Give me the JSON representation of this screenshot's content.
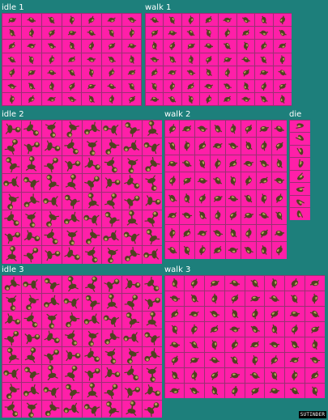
{
  "colors": {
    "background": "#1d7f7b",
    "cell": "#ff1fa8",
    "grid_line": "#9a2f72",
    "sprite_dark": "#4f4220",
    "sprite_light": "#b9a15a"
  },
  "sheet": {
    "sections": [
      {
        "id": "idle-1",
        "label": "idle 1",
        "cols": 7,
        "rows": 7,
        "pose": "small"
      },
      {
        "id": "walk-1",
        "label": "walk 1",
        "cols": 8,
        "rows": 7,
        "pose": "small"
      },
      {
        "id": "idle-2",
        "label": "idle 2",
        "cols": 8,
        "rows": 8,
        "pose": "large"
      },
      {
        "id": "walk-2",
        "label": "walk 2",
        "cols": 8,
        "rows": 8,
        "pose": "walk"
      },
      {
        "id": "die",
        "label": "die",
        "cols": 1,
        "rows": 8,
        "pose": "die"
      },
      {
        "id": "idle-3",
        "label": "idle 3",
        "cols": 8,
        "rows": 8,
        "pose": "large"
      },
      {
        "id": "walk-3",
        "label": "walk 3",
        "cols": 8,
        "rows": 8,
        "pose": "walk"
      }
    ]
  },
  "credit": "SUTINDER"
}
